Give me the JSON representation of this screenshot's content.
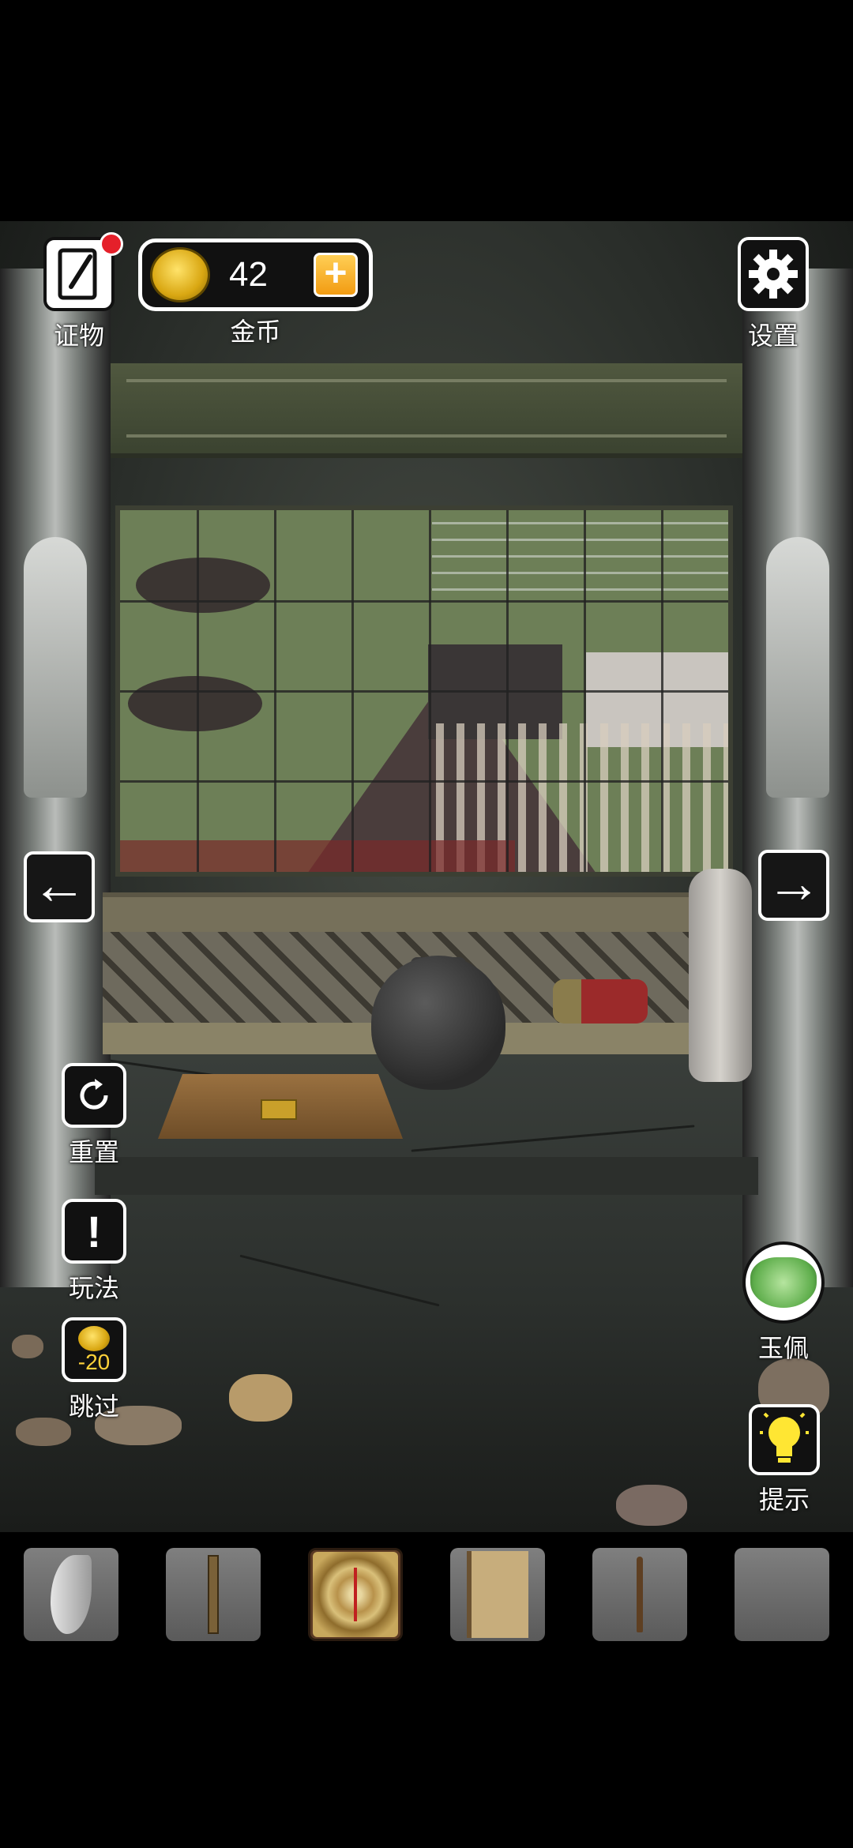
{
  "hud": {
    "evidence_label": "证物",
    "coins_value": "42",
    "coins_label": "金币",
    "settings_label": "设置",
    "reset_label": "重置",
    "howto_label": "玩法",
    "howto_glyph": "!",
    "skip_cost": "-20",
    "skip_label": "跳过",
    "jade_label": "玉佩",
    "hint_label": "提示"
  },
  "nav": {
    "left_arrow": "←",
    "right_arrow": "→"
  },
  "icons": {
    "evidence": "notebook-pen-icon",
    "settings": "gear-icon",
    "reset": "refresh-icon",
    "howto": "exclamation-icon",
    "skip": "coin-icon",
    "jade": "jade-pendant-icon",
    "hint": "lightbulb-icon"
  },
  "colors": {
    "badge": "#e5202a",
    "coin_plus": "#f29b12",
    "hint_bulb": "#ffe633",
    "jade": "#7cc36b"
  },
  "inventory": {
    "items": [
      {
        "name": "horn-claw"
      },
      {
        "name": "wooden-stick"
      },
      {
        "name": "compass-luopan",
        "selected": true
      },
      {
        "name": "old-book"
      },
      {
        "name": "walking-cane"
      },
      {
        "name": "empty"
      }
    ]
  }
}
